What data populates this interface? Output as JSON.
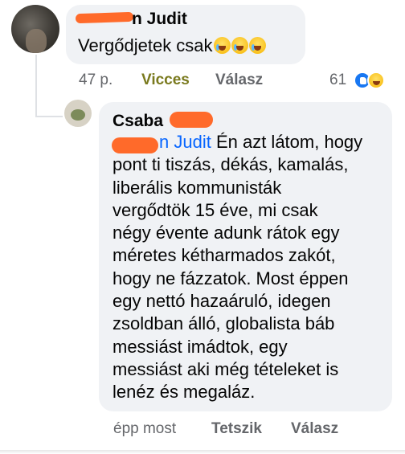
{
  "comment1": {
    "author_name": "n Judit",
    "text": "Vergődjetek csak",
    "emoji_icons": [
      "crying-laughing-emoji",
      "crying-laughing-emoji",
      "crying-laughing-emoji"
    ],
    "time": "47 p.",
    "reaction_label": "Vicces",
    "reply_label": "Válasz",
    "reaction_count": "61",
    "reaction_icons": [
      "like-icon",
      "haha-icon"
    ]
  },
  "comment2": {
    "author_name": "Csaba",
    "mention": "n Judit",
    "lines": [
      "Én azt látom, hogy",
      "pont ti tiszás, dékás, kamalás,",
      "liberális kommunisták",
      "vergődtök 15 éve, mi csak",
      "négy évente adunk rátok egy",
      "méretes kétharmados zakót,",
      "hogy ne fázzatok. Most éppen",
      "egy nettó hazaáruló, idegen",
      "zsoldban álló, globalista báb",
      "messiást imádtok, egy",
      "messiást aki még tételeket is",
      "lenéz és megaláz."
    ],
    "time": "épp most",
    "like_label": "Tetszik",
    "reply_label": "Válasz"
  },
  "colors": {
    "bubble": "#f0f2f5",
    "mention": "#0866ff",
    "meta": "#65676b",
    "reaction_label": "#7a7a1e",
    "redaction": "#ff6a2a"
  }
}
